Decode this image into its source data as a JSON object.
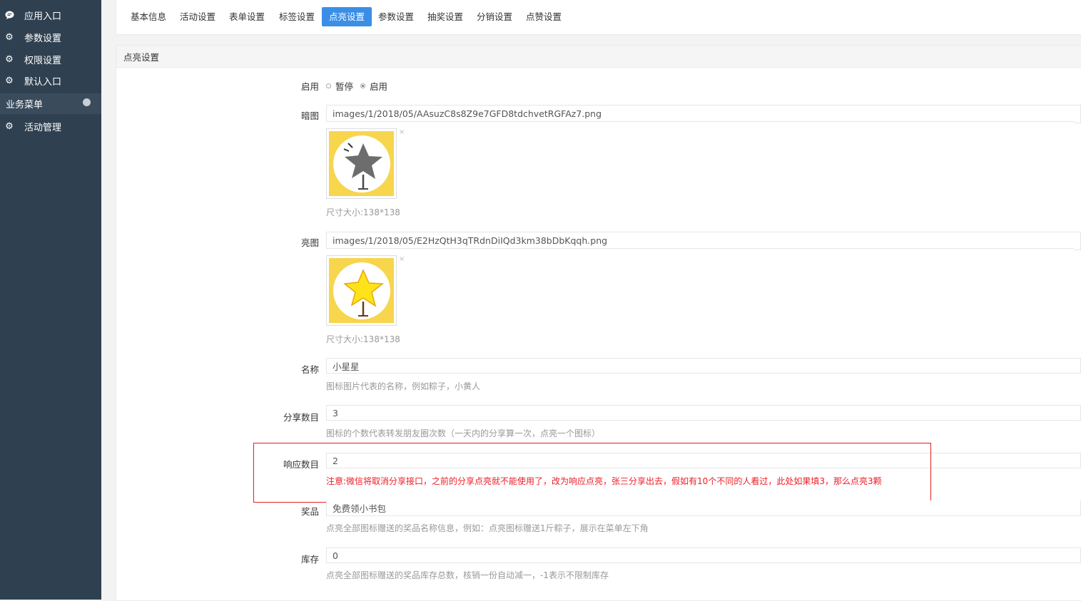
{
  "sidebar": {
    "items": [
      {
        "label": "应用入口",
        "icon": "chat-bubble-icon"
      },
      {
        "label": "参数设置",
        "icon": "gear-icon"
      },
      {
        "label": "权限设置",
        "icon": "gear-icon"
      },
      {
        "label": "默认入口",
        "icon": "gear-icon"
      }
    ],
    "group_label": "业务菜单",
    "group_items": [
      {
        "label": "活动管理",
        "icon": "gear-icon"
      }
    ]
  },
  "tabs": [
    {
      "label": "基本信息"
    },
    {
      "label": "活动设置"
    },
    {
      "label": "表单设置"
    },
    {
      "label": "标签设置"
    },
    {
      "label": "点亮设置",
      "active": true
    },
    {
      "label": "参数设置"
    },
    {
      "label": "抽奖设置"
    },
    {
      "label": "分销设置"
    },
    {
      "label": "点赞设置"
    }
  ],
  "panel": {
    "title": "点亮设置",
    "enable": {
      "label": "启用",
      "options": [
        "暂停",
        "启用"
      ],
      "selected": "启用"
    },
    "dark_image": {
      "label": "暗图",
      "path": "images/1/2018/05/AAsuzC8s8Z9e7GFD8tdchvetRGFAz7.png",
      "size_note": "尺寸大小:138*138",
      "close": "×"
    },
    "light_image": {
      "label": "亮图",
      "path": "images/1/2018/05/E2HzQtH3qTRdnDiIQd3km38bDbKqqh.png",
      "size_note": "尺寸大小:138*138",
      "close": "×"
    },
    "name": {
      "label": "名称",
      "value": "小星星",
      "help": "图标图片代表的名称，例如粽子，小黄人"
    },
    "share_count": {
      "label": "分享数目",
      "value": "3",
      "help": "图标的个数代表转发朋友圈次数（一天内的分享算一次，点亮一个图标）"
    },
    "response_count": {
      "label": "响应数目",
      "value": "2",
      "warning": "注意:微信将取消分享接口，之前的分享点亮就不能使用了，改为响应点亮，张三分享出去，假如有10个不同的人看过，此处如果填3，那么点亮3颗"
    },
    "prize": {
      "label": "奖品",
      "value": "免费领小书包",
      "help": "点亮全部图标赠送的奖品名称信息，例如：点亮图标赠送1斤粽子，展示在菜单左下角"
    },
    "stock": {
      "label": "库存",
      "value": "0",
      "help": "点亮全部图标赠送的奖品库存总数，核销一份自动减一，-1表示不限制库存"
    }
  },
  "colors": {
    "sidebar_bg": "#2f4050",
    "active_tab": "#3a8ee6",
    "warning": "#ed1c24",
    "highlight_border": "#e02020",
    "thumb_bg": "#f7d54d"
  }
}
